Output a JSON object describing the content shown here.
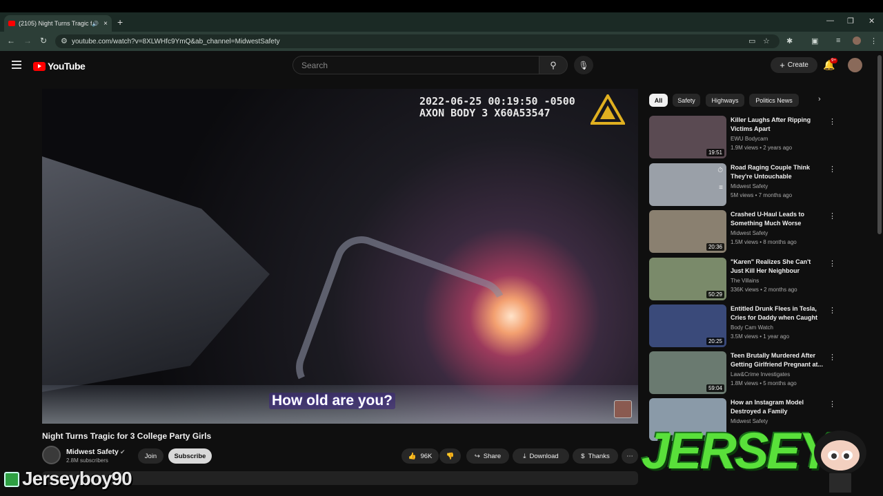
{
  "browser": {
    "tab_title": "(2105) Night Turns Tragic fo",
    "tab_close": "×",
    "new_tab": "+",
    "url": "youtube.com/watch?v=8XLWHfc9YmQ&ab_channel=MidwestSafety",
    "window_controls": [
      "—",
      "❐",
      "✕"
    ]
  },
  "header": {
    "logo_text": "YouTube",
    "search_placeholder": "Search",
    "create_label": "Create",
    "notif_badge": "9+"
  },
  "video": {
    "timestamp_line1": "2022-06-25 00:19:50 -0500",
    "timestamp_line2": "AXON BODY 3 X60A53547",
    "caption": "How old are you?",
    "title": "Night Turns Tragic for 3 College Party Girls"
  },
  "channel": {
    "name": "Midwest Safety",
    "subscribers": "2.8M subscribers",
    "join_label": "Join",
    "subscribe_label": "Subscribe"
  },
  "actions": {
    "likes": "96K",
    "share_label": "Share",
    "download_label": "Download",
    "thanks_label": "Thanks"
  },
  "chips": [
    "All",
    "Safety",
    "Highways",
    "Politics News"
  ],
  "recommendations": [
    {
      "title": "Killer Laughs After Ripping Victims Apart",
      "channel": "EWU Bodycam",
      "meta": "1.9M views • 2 years ago",
      "duration": "19:51",
      "color": "#5a4a52"
    },
    {
      "title": "Road Raging Couple Think They're Untouchable",
      "channel": "Midwest Safety",
      "meta": "5M views • 7 months ago",
      "duration": "",
      "color": "#9aa0a8"
    },
    {
      "title": "Crashed U-Haul Leads to Something Much Worse",
      "channel": "Midwest Safety",
      "meta": "1.5M views • 8 months ago",
      "duration": "20:36",
      "color": "#8a8070"
    },
    {
      "title": "\"Karen\" Realizes She Can't Just Kill Her Neighbour",
      "channel": "The Villains",
      "meta": "336K views • 2 months ago",
      "duration": "50:29",
      "color": "#7a8a6a"
    },
    {
      "title": "Entitled Drunk Flees in Tesla, Cries for Daddy when Caught",
      "channel": "Body Cam Watch",
      "meta": "3.5M views • 1 year ago",
      "duration": "20:25",
      "color": "#3a4a7a"
    },
    {
      "title": "Teen Brutally Murdered After Getting Girlfriend Pregnant at...",
      "channel": "Law&Crime Investigates",
      "meta": "1.8M views • 5 months ago",
      "duration": "59:04",
      "color": "#6a7a70"
    },
    {
      "title": "How an Instagram Model Destroyed a Family",
      "channel": "Midwest Safety",
      "meta": "",
      "duration": "",
      "color": "#8a9aa8"
    }
  ],
  "overlays": {
    "streamer_tag": "Jerseyboy90",
    "logo_text": "JERSEY"
  }
}
